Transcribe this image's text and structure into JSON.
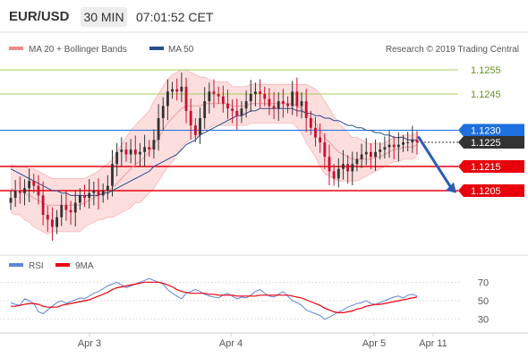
{
  "header": {
    "pair": "EUR/USD",
    "timeframe": "30 MIN",
    "time": "07:01:52 CET"
  },
  "legend": {
    "bollinger_label": "MA 20 + Bollinger Bands",
    "ma50_label": "MA 50",
    "credit": "Research © 2019 Trading Central",
    "rsi_label": "RSI",
    "ma9_label": "9MA"
  },
  "colors": {
    "up_candle": "#333333",
    "down_candle": "#c8102e",
    "bollinger_fill": "#fbd3d3",
    "ma20": "#e9a0a0",
    "ma50": "#2a4d8c",
    "resistance_green": "#a6cf59",
    "support_red": "#e8000b",
    "pivot_blue": "#1e6fe0",
    "current_dark": "#333333",
    "rsi": "#5d86d8",
    "ma9": "#e8000b",
    "arrow": "#2b5db5"
  },
  "chart_data": [
    {
      "type": "candlestick",
      "title": "EUR/USD 30 MIN",
      "x_ticks": [
        "Apr 3",
        "Apr 4",
        "Apr 5",
        "Apr 11"
      ],
      "levels": [
        {
          "value": 1.1255,
          "label": "1.1255",
          "role": "resistance",
          "color": "#a6cf59"
        },
        {
          "value": 1.1245,
          "label": "1.1245",
          "role": "resistance",
          "color": "#a6cf59"
        },
        {
          "value": 1.123,
          "label": "1.1230",
          "role": "pivot",
          "color": "#1e6fe0"
        },
        {
          "value": 1.1225,
          "label": "1.1225",
          "role": "current",
          "color": "#333333"
        },
        {
          "value": 1.1215,
          "label": "1.1215",
          "role": "support",
          "color": "#e8000b"
        },
        {
          "value": 1.1205,
          "label": "1.1205",
          "role": "support",
          "color": "#e8000b"
        }
      ],
      "close": [
        1.1202,
        1.1205,
        1.1204,
        1.1206,
        1.1209,
        1.1207,
        1.1203,
        1.1195,
        1.1193,
        1.119,
        1.1194,
        1.1199,
        1.1197,
        1.1196,
        1.12,
        1.1203,
        1.1202,
        1.1204,
        1.1205,
        1.1203,
        1.1205,
        1.1207,
        1.1216,
        1.1221,
        1.1222,
        1.122,
        1.1222,
        1.122,
        1.1221,
        1.1223,
        1.1222,
        1.1226,
        1.1235,
        1.124,
        1.1246,
        1.1247,
        1.1246,
        1.1248,
        1.1238,
        1.1232,
        1.1228,
        1.1235,
        1.1242,
        1.1246,
        1.1245,
        1.1244,
        1.1241,
        1.1239,
        1.1238,
        1.1236,
        1.1239,
        1.1242,
        1.1245,
        1.1246,
        1.1245,
        1.1243,
        1.124,
        1.1239,
        1.1242,
        1.1241,
        1.124,
        1.1246,
        1.124,
        1.1242,
        1.1235,
        1.1231,
        1.1227,
        1.1225,
        1.1219,
        1.1213,
        1.121,
        1.1214,
        1.1216,
        1.1213,
        1.1216,
        1.1218,
        1.122,
        1.1221,
        1.1219,
        1.1221,
        1.1222,
        1.1223,
        1.1224,
        1.1223,
        1.1224,
        1.1225,
        1.1225,
        1.1226,
        1.1225
      ],
      "ma20": [
        1.1206,
        1.1205,
        1.1205,
        1.1204,
        1.1203,
        1.1202,
        1.1201,
        1.12,
        1.1199,
        1.1199,
        1.1199,
        1.1199,
        1.1199,
        1.1199,
        1.1199,
        1.1199,
        1.12,
        1.1201,
        1.1202,
        1.1203,
        1.1204,
        1.1205,
        1.1206,
        1.1208,
        1.121,
        1.1212,
        1.1214,
        1.1216,
        1.1217,
        1.1219,
        1.1221,
        1.1224,
        1.1227,
        1.123,
        1.1233,
        1.1235,
        1.1237,
        1.1239,
        1.124,
        1.124,
        1.124,
        1.124,
        1.1241,
        1.1241,
        1.1241,
        1.1241,
        1.1241,
        1.1241,
        1.124,
        1.124,
        1.124,
        1.124,
        1.1241,
        1.1241,
        1.1241,
        1.1241,
        1.1241,
        1.1241,
        1.1241,
        1.1241,
        1.1241,
        1.1241,
        1.124,
        1.1239,
        1.1237,
        1.1235,
        1.1233,
        1.123,
        1.1227,
        1.1225,
        1.1223,
        1.1221,
        1.122,
        1.1219,
        1.1218,
        1.1218,
        1.1218,
        1.1218,
        1.1218,
        1.1219,
        1.1219,
        1.122,
        1.1221,
        1.1222,
        1.1222,
        1.1223,
        1.1223,
        1.1223,
        1.1224
      ],
      "ma50": [
        1.1214,
        1.1213,
        1.1212,
        1.1211,
        1.121,
        1.1209,
        1.1208,
        1.1207,
        1.1206,
        1.1205,
        1.1205,
        1.1204,
        1.1204,
        1.1203,
        1.1203,
        1.1203,
        1.1203,
        1.1203,
        1.1203,
        1.1203,
        1.1204,
        1.1204,
        1.1205,
        1.1206,
        1.1207,
        1.1208,
        1.1209,
        1.121,
        1.1211,
        1.1212,
        1.1213,
        1.1215,
        1.1216,
        1.1217,
        1.1218,
        1.1219,
        1.122,
        1.1222,
        1.1224,
        1.1225,
        1.1226,
        1.1228,
        1.1229,
        1.123,
        1.1231,
        1.1232,
        1.1233,
        1.1234,
        1.1235,
        1.1236,
        1.1236,
        1.1237,
        1.1238,
        1.1238,
        1.1239,
        1.1239,
        1.1239,
        1.1239,
        1.1239,
        1.1239,
        1.1239,
        1.1239,
        1.1238,
        1.1238,
        1.1237,
        1.1237,
        1.1236,
        1.1236,
        1.1235,
        1.1235,
        1.1234,
        1.1234,
        1.1233,
        1.1232,
        1.1232,
        1.1231,
        1.1231,
        1.123,
        1.123,
        1.1229,
        1.1229,
        1.1228,
        1.1228,
        1.1227,
        1.1227,
        1.1227,
        1.1226,
        1.1226,
        1.1226
      ],
      "bollinger_width": [
        0.001,
        0.001,
        0.001,
        0.0011,
        0.0011,
        0.0012,
        0.0012,
        0.0012,
        0.0012,
        0.0011,
        0.0011,
        0.0011,
        0.0011,
        0.0011,
        0.0011,
        0.0011,
        0.001,
        0.001,
        0.001,
        0.001,
        0.0011,
        0.0011,
        0.0012,
        0.0013,
        0.0014,
        0.0015,
        0.0016,
        0.0016,
        0.0017,
        0.0017,
        0.0017,
        0.0018,
        0.0018,
        0.0018,
        0.0018,
        0.0018,
        0.0017,
        0.0016,
        0.0015,
        0.0014,
        0.0013,
        0.0012,
        0.0011,
        0.001,
        0.0009,
        0.0009,
        0.0009,
        0.0009,
        0.0008,
        0.0008,
        0.0008,
        0.0008,
        0.0008,
        0.0008,
        0.0008,
        0.0008,
        0.0008,
        0.0008,
        0.0008,
        0.0008,
        0.0008,
        0.0008,
        0.0009,
        0.001,
        0.0012,
        0.0013,
        0.0014,
        0.0015,
        0.0015,
        0.0014,
        0.0013,
        0.0012,
        0.0011,
        0.001,
        0.0009,
        0.0009,
        0.0008,
        0.0007,
        0.0006,
        0.0006,
        0.0005,
        0.0005,
        0.0005,
        0.0005,
        0.0005,
        0.0005,
        0.0005,
        0.0005,
        0.0005
      ],
      "arrow": {
        "from": 1.1227,
        "to": 1.1204
      }
    },
    {
      "type": "line",
      "title": "RSI",
      "y_ticks": [
        30,
        50,
        70
      ],
      "ylim": [
        20,
        80
      ],
      "x_ticks": [
        "Apr 3",
        "Apr 4",
        "Apr 5",
        "Apr 11"
      ],
      "series": [
        {
          "name": "RSI",
          "values": [
            48,
            46,
            45,
            52,
            50,
            47,
            38,
            36,
            40,
            44,
            48,
            50,
            47,
            49,
            51,
            53,
            52,
            55,
            58,
            60,
            63,
            66,
            68,
            70,
            67,
            64,
            66,
            68,
            70,
            72,
            74,
            72,
            70,
            68,
            62,
            58,
            55,
            52,
            58,
            60,
            62,
            60,
            57,
            55,
            54,
            53,
            56,
            58,
            55,
            52,
            54,
            53,
            56,
            60,
            62,
            58,
            55,
            54,
            57,
            60,
            55,
            50,
            48,
            45,
            40,
            38,
            36,
            34,
            30,
            32,
            35,
            38,
            40,
            43,
            45,
            47,
            48,
            50,
            47,
            46,
            48,
            50,
            52,
            54,
            55,
            53,
            56,
            57,
            55
          ]
        },
        {
          "name": "9MA",
          "values": [
            44,
            44,
            45,
            46,
            47,
            47,
            46,
            44,
            43,
            43,
            43,
            45,
            46,
            47,
            48,
            49,
            50,
            51,
            53,
            55,
            57,
            59,
            62,
            64,
            65,
            66,
            67,
            68,
            69,
            70,
            70,
            70,
            70,
            69,
            67,
            65,
            62,
            60,
            59,
            58,
            58,
            58,
            58,
            57,
            57,
            56,
            56,
            56,
            56,
            55,
            55,
            55,
            55,
            55,
            56,
            56,
            56,
            56,
            56,
            56,
            56,
            55,
            54,
            53,
            51,
            49,
            47,
            45,
            42,
            40,
            38,
            37,
            37,
            38,
            39,
            41,
            42,
            44,
            45,
            46,
            46,
            47,
            48,
            49,
            50,
            51,
            52,
            53,
            54
          ]
        }
      ]
    }
  ]
}
